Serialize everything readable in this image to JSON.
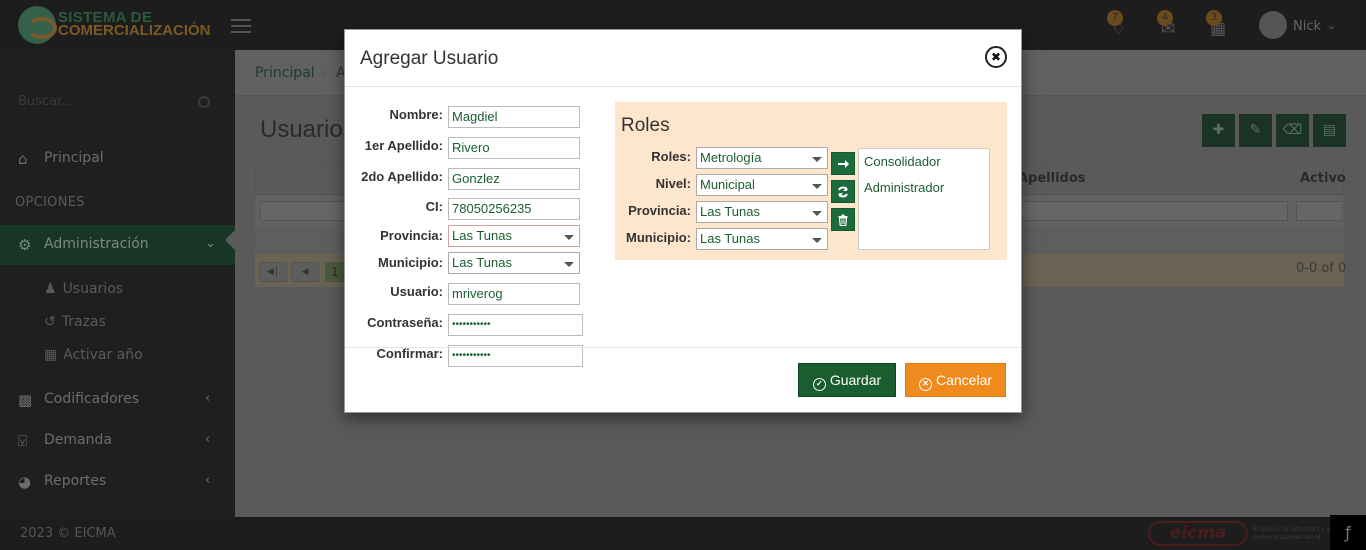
{
  "app": {
    "logo_line1": "SISTEMA DE",
    "logo_line2": "COMERCIALIZACIÓN",
    "notifications": [
      {
        "icon": "bell-icon",
        "count": "7"
      },
      {
        "icon": "envelope-icon",
        "count": "4"
      },
      {
        "icon": "calendar-icon",
        "count": "3"
      }
    ],
    "user_name": "Nick"
  },
  "sidebar": {
    "search_placeholder": "Buscar...",
    "principal": "Principal",
    "section_heading": "OPCIONES",
    "administracion": "Administración",
    "sub_items": [
      "Usuarios",
      "Trazas",
      "Activar año"
    ],
    "codificadores": "Codificadores",
    "demanda": "Demanda",
    "reportes": "Reportes"
  },
  "breadcrumb": {
    "home": "Principal",
    "current": "A"
  },
  "page": {
    "title": "Usuarios",
    "columns": {
      "apellidos": "Apellidos",
      "activo": "Activo"
    },
    "pager_page": "1",
    "pager_info": "0-0 of 0"
  },
  "footer": {
    "copyright": "2023 © EICMA",
    "company_logo": "eicma",
    "company_note": "Empresa de Informática y Comunicaciones del M"
  },
  "modal": {
    "title": "Agregar Usuario",
    "fields": {
      "nombre_label": "Nombre:",
      "nombre": "Magdiel",
      "apellido1_label": "1er Apellido:",
      "apellido1": "Rivero",
      "apellido2_label": "2do Apellido:",
      "apellido2": "Gonzlez",
      "ci_label": "CI:",
      "ci": "78050256235",
      "provincia_label": "Provincia:",
      "provincia": "Las Tunas",
      "municipio_label": "Municipio:",
      "municipio": "Las Tunas",
      "usuario_label": "Usuario:",
      "usuario": "mriverog",
      "contrasena_label": "Contraseña:",
      "contrasena": "•••••••••••",
      "confirmar_label": "Confirmar:",
      "confirmar": "•••••••••••"
    },
    "roles": {
      "title": "Roles",
      "roles_label": "Roles:",
      "roles_value": "Metrología",
      "nivel_label": "Nivel:",
      "nivel_value": "Municipal",
      "provincia_label": "Provincia:",
      "provincia_value": "Las Tunas",
      "municipio_label": "Municipio:",
      "municipio_value": "Las Tunas",
      "assigned": [
        "Consolidador",
        "Administrador"
      ]
    },
    "save_label": "Guardar",
    "cancel_label": "Cancelar",
    "colors": {
      "save": "#1a5e30",
      "cancel": "#ef8a1c",
      "roles_panel": "#fde6cc"
    }
  }
}
